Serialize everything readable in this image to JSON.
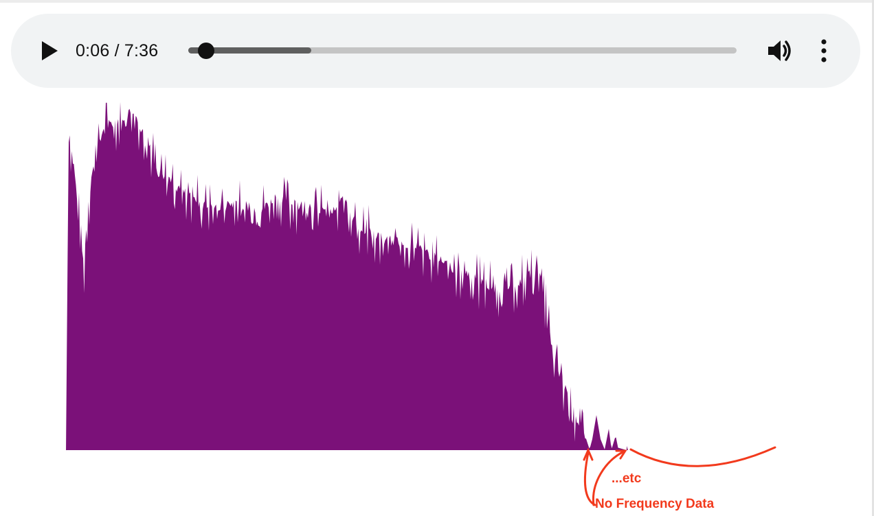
{
  "player": {
    "time_display": "0:06 / 7:36",
    "progress_fraction": 0.224,
    "buffered_fraction": 0.224,
    "icons": {
      "play": "play-icon",
      "volume": "volume-icon",
      "more": "more-vertical-icon"
    }
  },
  "visualizer": {
    "fill_color": "#7b1179"
  },
  "annotations": {
    "etc_label": "...etc",
    "no_data_label": "No Frequency Data",
    "color": "#f23a1d"
  }
}
